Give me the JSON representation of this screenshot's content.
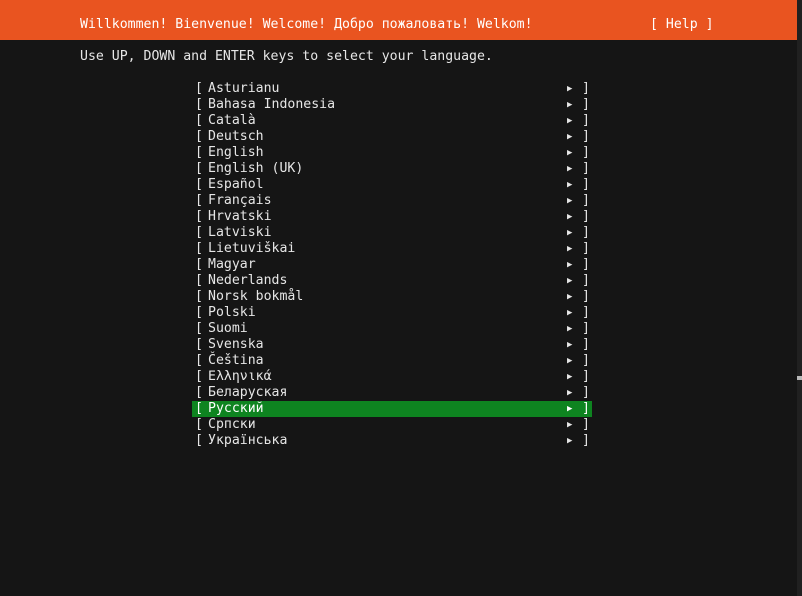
{
  "header": {
    "title": "Willkommen! Bienvenue! Welcome! Добро пожаловать! Welkom!",
    "help_label": "[ Help ]"
  },
  "instructions": "Use UP, DOWN and ENTER keys to select your language.",
  "colors": {
    "header_bg": "#e95420",
    "selected_bg": "#0e8420",
    "screen_bg": "#151515"
  },
  "languages": [
    {
      "label": "Asturianu",
      "selected": false
    },
    {
      "label": "Bahasa Indonesia",
      "selected": false
    },
    {
      "label": "Català",
      "selected": false
    },
    {
      "label": "Deutsch",
      "selected": false
    },
    {
      "label": "English",
      "selected": false
    },
    {
      "label": "English (UK)",
      "selected": false
    },
    {
      "label": "Español",
      "selected": false
    },
    {
      "label": "Français",
      "selected": false
    },
    {
      "label": "Hrvatski",
      "selected": false
    },
    {
      "label": "Latviski",
      "selected": false
    },
    {
      "label": "Lietuviškai",
      "selected": false
    },
    {
      "label": "Magyar",
      "selected": false
    },
    {
      "label": "Nederlands",
      "selected": false
    },
    {
      "label": "Norsk bokmål",
      "selected": false
    },
    {
      "label": "Polski",
      "selected": false
    },
    {
      "label": "Suomi",
      "selected": false
    },
    {
      "label": "Svenska",
      "selected": false
    },
    {
      "label": "Čeština",
      "selected": false
    },
    {
      "label": "Ελληνικά",
      "selected": false
    },
    {
      "label": "Беларуская",
      "selected": false
    },
    {
      "label": "Русский",
      "selected": true
    },
    {
      "label": "Српски",
      "selected": false
    },
    {
      "label": "Українська",
      "selected": false
    }
  ],
  "list_markers": {
    "open": "[",
    "close": "]",
    "arrow": "▶",
    "arrow_icon": "right-triangle-icon"
  }
}
